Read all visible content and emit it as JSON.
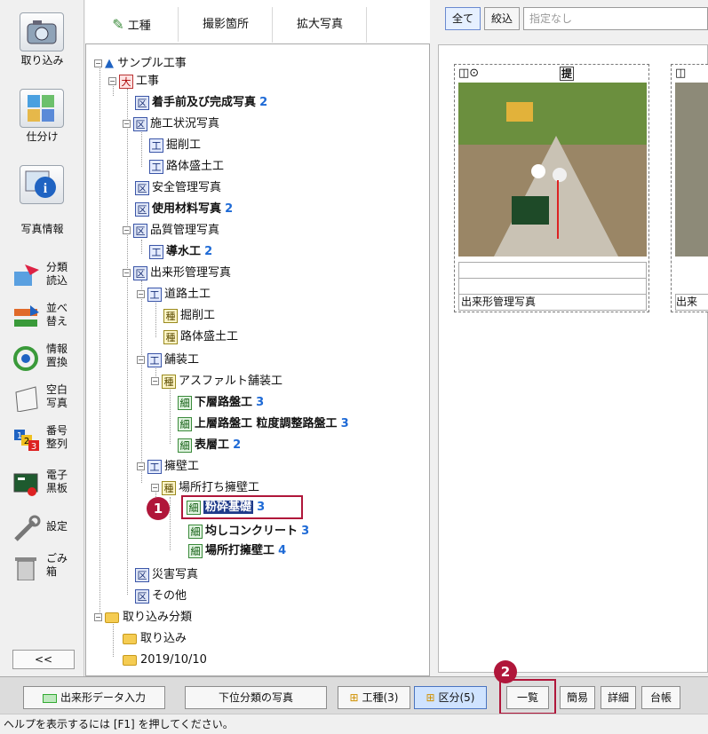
{
  "leftbar": {
    "big_buttons": [
      {
        "label": "取り込み",
        "icon": "camera-icon"
      },
      {
        "label": "仕分け",
        "icon": "sort-grid-icon"
      },
      {
        "label": "写真情報",
        "icon": "info-icon"
      }
    ],
    "small_buttons": [
      {
        "label": "分類\n読込",
        "icon": "classify-load-icon"
      },
      {
        "label": "並べ\n替え",
        "icon": "sort-arrows-icon"
      },
      {
        "label": "情報\n置換",
        "icon": "replace-icon"
      },
      {
        "label": "空白\n写真",
        "icon": "blank-photo-icon"
      },
      {
        "label": "番号\n整列",
        "icon": "number-sort-icon"
      },
      {
        "label": "電子\n黒板",
        "icon": "blackboard-icon"
      },
      {
        "label": "設定",
        "icon": "wrench-icon"
      },
      {
        "label": "ごみ\n箱",
        "icon": "trash-icon"
      }
    ],
    "collapse_label": "<<"
  },
  "tabs": [
    {
      "label": "工種",
      "icon": "pencil-icon",
      "active": true
    },
    {
      "label": "撮影箇所",
      "active": false
    },
    {
      "label": "拡大写真",
      "active": false
    }
  ],
  "tree": {
    "root": "サンプル工事",
    "dai": "工事",
    "k1": "着手前及び完成写真",
    "k1_count": "2",
    "k2": "施工状況写真",
    "k2a": "掘削工",
    "k2b": "路体盛土工",
    "k3": "安全管理写真",
    "k4": "使用材料写真",
    "k4_count": "2",
    "k5": "品質管理写真",
    "k5a": "導水工",
    "k5a_count": "2",
    "k6": "出来形管理写真",
    "k6a": "道路土工",
    "k6a1": "掘削工",
    "k6a2": "路体盛土工",
    "k6b": "舗装工",
    "k6b1": "アスファルト舗装工",
    "k6b1a": "下層路盤工",
    "k6b1a_count": "3",
    "k6b1b": "上層路盤工 粒度調整路盤工",
    "k6b1b_count": "3",
    "k6b1c": "表層工",
    "k6b1c_count": "2",
    "k6c": "擁壁工",
    "k6c1": "場所打ち擁壁工",
    "k6c1a": "粉砕基礎",
    "k6c1a_count": "3",
    "k6c1b": "均しコンクリート",
    "k6c1b_count": "3",
    "k6c1c": "場所打擁壁工",
    "k6c1c_count": "4",
    "k7": "災害写真",
    "k8": "その他",
    "imp": "取り込み分類",
    "imp1": "取り込み",
    "imp2": "2019/10/10",
    "tags": {
      "ku": "区",
      "dai": "大",
      "ko": "工",
      "shu": "種",
      "sai": "細"
    }
  },
  "right": {
    "filter_all": "全て",
    "filter_narrow": "絞込",
    "filter_placeholder": "指定なし",
    "card1_badge": "提",
    "card1_caption": "出来形管理写真",
    "card2_caption": "出来"
  },
  "bottom": {
    "btn1": "出来形データ入力",
    "btn2": "下位分類の写真",
    "btn3": "工種(3)",
    "btn4": "区分(5)",
    "btn5": "一覧",
    "btn6": "簡易",
    "btn7": "詳細",
    "btn8": "台帳"
  },
  "status": "ヘルプを表示するには [F1] を押してください。",
  "callouts": {
    "c1": "1",
    "c2": "2"
  },
  "colors": {
    "highlight": "#b0163a",
    "count_blue": "#1e6ad6",
    "selection": "#1f3a8a"
  }
}
